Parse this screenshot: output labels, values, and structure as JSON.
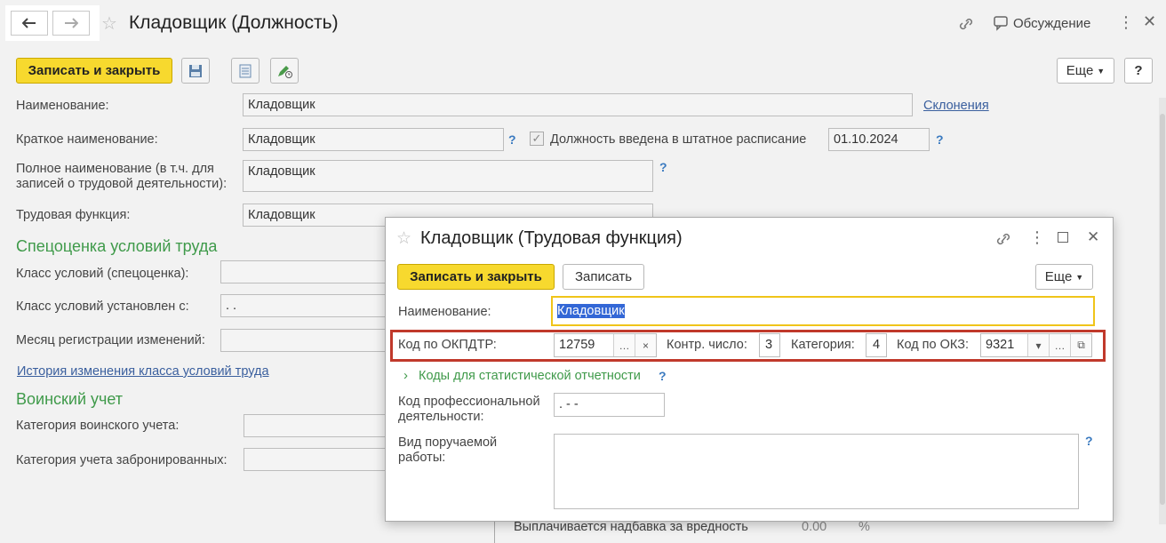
{
  "window": {
    "title": "Кладовщик (Должность)",
    "discussion_label": "Обсуждение"
  },
  "toolbar": {
    "save_close_label": "Записать и закрыть",
    "more_label": "Еще",
    "help_label": "?"
  },
  "form": {
    "name_label": "Наименование:",
    "name_value": "Кладовщик",
    "declensions_link": "Склонения",
    "short_name_label": "Краткое наименование:",
    "short_name_value": "Кладовщик",
    "staff_checkbox_label": "Должность введена в штатное расписание",
    "staff_date": "01.10.2024",
    "full_name_label_1": "Полное наименование (в т.ч. для",
    "full_name_label_2": "записей о трудовой деятельности):",
    "full_name_value": "Кладовщик",
    "labor_function_label": "Трудовая функция:",
    "labor_function_value": "Кладовщик",
    "special_eval_header": "Спецоценка условий труда",
    "conditions_class_label": "Класс условий (спецоценка):",
    "conditions_set_label": "Класс условий установлен с:",
    "conditions_set_value": " .  .",
    "month_reg_label": "Месяц регистрации изменений:",
    "history_link": "История изменения класса условий труда",
    "military_header": "Воинский учет",
    "military_category_label": "Категория воинского учета:",
    "reserved_category_label": "Категория учета забронированных:",
    "hazard_label": "Выплачивается надбавка за вредность",
    "hazard_value": "0.00",
    "hazard_unit": "%"
  },
  "dialog": {
    "title": "Кладовщик (Трудовая функция)",
    "save_close_label": "Записать и закрыть",
    "save_label": "Записать",
    "more_label": "Еще",
    "name_label": "Наименование:",
    "name_value": "Кладовщик",
    "okpdtr_label": "Код по ОКПДТР:",
    "okpdtr_value": "12759",
    "control_label": "Контр. число:",
    "control_value": "3",
    "category_label": "Категория:",
    "category_value": "4",
    "okz_label": "Код по ОКЗ:",
    "okz_value": "9321",
    "stat_codes_label": "Коды для статистической отчетности",
    "prof_code_label_1": "Код профессиональной",
    "prof_code_label_2": "деятельности:",
    "prof_code_value": " .  - -",
    "work_type_label_1": "Вид поручаемой",
    "work_type_label_2": "работы:",
    "help": "?"
  },
  "colors": {
    "accent_yellow": "#f7d92e",
    "section_green": "#3f9a4a",
    "link_blue": "#3a5f9e",
    "highlight_red": "#c0392b",
    "focus_yellow": "#f0c419"
  }
}
